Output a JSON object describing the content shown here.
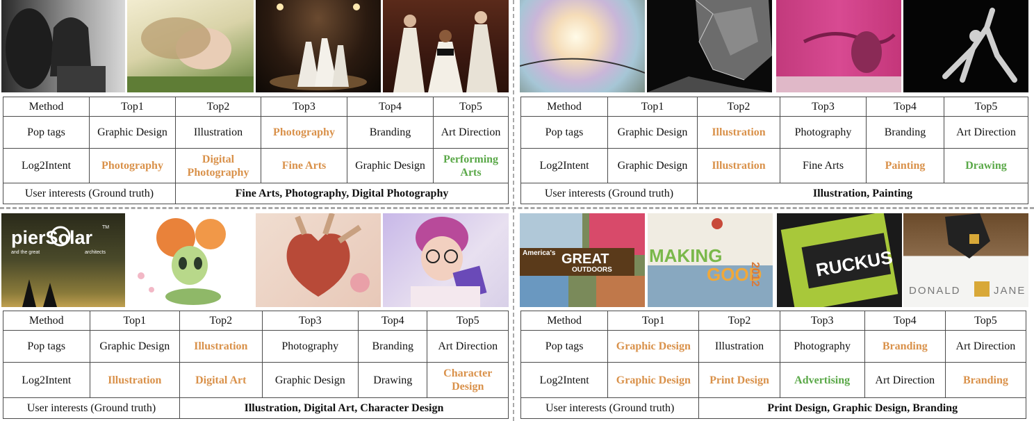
{
  "panels": [
    {
      "images": [
        "girl-with-horse-photo",
        "woman-lying-in-grass-photo",
        "dancers-on-stage-photo",
        "three-women-fashion-photo"
      ],
      "headers": [
        "Method",
        "Top1",
        "Top2",
        "Top3",
        "Top4",
        "Top5"
      ],
      "rows": [
        {
          "label": "Pop tags",
          "cells": [
            {
              "t": "Graphic Design",
              "c": ""
            },
            {
              "t": "Illustration",
              "c": ""
            },
            {
              "t": "Photography",
              "c": "orange"
            },
            {
              "t": "Branding",
              "c": ""
            },
            {
              "t": "Art Direction",
              "c": ""
            }
          ]
        },
        {
          "label": "Log2Intent",
          "cells": [
            {
              "t": "Photography",
              "c": "orange"
            },
            {
              "t": "Digital Photography",
              "c": "orange"
            },
            {
              "t": "Fine Arts",
              "c": "orange"
            },
            {
              "t": "Graphic Design",
              "c": ""
            },
            {
              "t": "Performing Arts",
              "c": "green"
            }
          ]
        }
      ],
      "gt_label": "User interests (Ground truth)",
      "gt_value": "Fine Arts, Photography, Digital Photography"
    },
    {
      "images": [
        "abstract-light-art",
        "polygon-face-art",
        "pink-painting-art",
        "sparkle-figure-art"
      ],
      "headers": [
        "Method",
        "Top1",
        "Top2",
        "Top3",
        "Top4",
        "Top5"
      ],
      "rows": [
        {
          "label": "Pop tags",
          "cells": [
            {
              "t": "Graphic Design",
              "c": ""
            },
            {
              "t": "Illustration",
              "c": "orange"
            },
            {
              "t": "Photography",
              "c": ""
            },
            {
              "t": "Branding",
              "c": ""
            },
            {
              "t": "Art Direction",
              "c": ""
            }
          ]
        },
        {
          "label": "Log2Intent",
          "cells": [
            {
              "t": "Graphic Design",
              "c": ""
            },
            {
              "t": "Illustration",
              "c": "orange"
            },
            {
              "t": "Fine Arts",
              "c": ""
            },
            {
              "t": "Painting",
              "c": "orange"
            },
            {
              "t": "Drawing",
              "c": "green"
            }
          ]
        }
      ],
      "gt_label": "User interests (Ground truth)",
      "gt_value": "Illustration, Painting"
    },
    {
      "images": [
        "pier-solar-game-art",
        "flower-character-art",
        "anatomical-heart-art",
        "girl-with-glasses-art"
      ],
      "logo_text": {
        "main": "pierSolar",
        "tm": "TM",
        "sub1": "and the great",
        "sub2": "architects"
      },
      "headers": [
        "Method",
        "Top1",
        "Top2",
        "Top3",
        "Top4",
        "Top5"
      ],
      "rows": [
        {
          "label": "Pop tags",
          "cells": [
            {
              "t": "Graphic Design",
              "c": ""
            },
            {
              "t": "Illustration",
              "c": "orange"
            },
            {
              "t": "Photography",
              "c": ""
            },
            {
              "t": "Branding",
              "c": ""
            },
            {
              "t": "Art Direction",
              "c": ""
            }
          ]
        },
        {
          "label": "Log2Intent",
          "cells": [
            {
              "t": "Illustration",
              "c": "orange"
            },
            {
              "t": "Digital Art",
              "c": "orange"
            },
            {
              "t": "Graphic Design",
              "c": ""
            },
            {
              "t": "Drawing",
              "c": ""
            },
            {
              "t": "Character Design",
              "c": "orange"
            }
          ]
        }
      ],
      "gt_label": "User interests (Ground truth)",
      "gt_value": "Illustration, Digital Art, Character Design"
    },
    {
      "images": [
        "great-outdoors-poster",
        "making-good-report",
        "ruckus-business-card",
        "donald-jane-logo"
      ],
      "logo_text": {
        "great1": "America's",
        "great2": "GREAT",
        "great3": "OUTDOORS",
        "making": "MAKING",
        "good": "GOOD",
        "year": "2012",
        "ruckus": "RUCKUS",
        "dj1": "DONALD",
        "dj2": "JANE"
      },
      "headers": [
        "Method",
        "Top1",
        "Top2",
        "Top3",
        "Top4",
        "Top5"
      ],
      "rows": [
        {
          "label": "Pop tags",
          "cells": [
            {
              "t": "Graphic Design",
              "c": "orange"
            },
            {
              "t": "Illustration",
              "c": ""
            },
            {
              "t": "Photography",
              "c": ""
            },
            {
              "t": "Branding",
              "c": "orange"
            },
            {
              "t": "Art Direction",
              "c": ""
            }
          ]
        },
        {
          "label": "Log2Intent",
          "cells": [
            {
              "t": "Graphic Design",
              "c": "orange"
            },
            {
              "t": "Print Design",
              "c": "orange"
            },
            {
              "t": "Advertising",
              "c": "green"
            },
            {
              "t": "Art Direction",
              "c": ""
            },
            {
              "t": "Branding",
              "c": "orange"
            }
          ]
        }
      ],
      "gt_label": "User interests (Ground truth)",
      "gt_value": "Print Design, Graphic Design, Branding"
    }
  ],
  "colors": {
    "match_orange": "#d9914a",
    "match_green": "#5aa848",
    "border": "#4a4a4a",
    "divider": "#a8a8a8"
  }
}
